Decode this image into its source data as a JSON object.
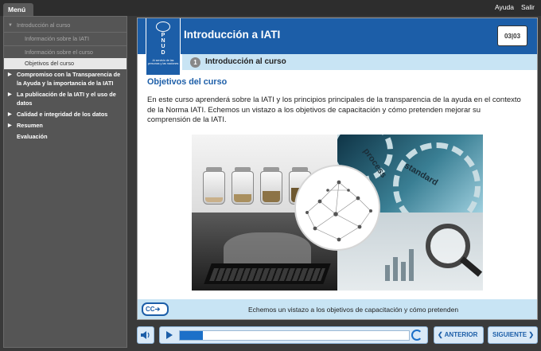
{
  "topbar": {
    "menu_label": "Menú",
    "help_label": "Ayuda",
    "exit_label": "Salir"
  },
  "sidebar": {
    "items": [
      {
        "label": "Introducción al curso"
      },
      {
        "label": "Información sobre la IATI"
      },
      {
        "label": "Información sobre el curso"
      },
      {
        "label": "Objetivos del curso"
      },
      {
        "label": "Compromiso con la Transparencia de la Ayuda y la importancia de la IATI"
      },
      {
        "label": "La publicación de la IATI y el uso de datos"
      },
      {
        "label": "Calidad e integridad de los datos"
      },
      {
        "label": "Resumen"
      },
      {
        "label": "Evaluación"
      }
    ]
  },
  "header": {
    "logo_text": "P\nN\nU\nD",
    "logo_tagline": "Al servicio de las personas y las naciones",
    "title": "Introducción a IATI",
    "page_current": "03",
    "page_total": "03"
  },
  "subheader": {
    "number": "1",
    "label": "Introducción al curso"
  },
  "content": {
    "section_title": "Objetivos del curso",
    "body": "En este curso aprenderá sobre la IATI y los principios principales de la transparencia de la ayuda en el contexto de la Norma IATI. Echemos un vistazo a los objetivos de capacitación y cómo pretenden mejorar su comprensión de la IATI.",
    "image_words": [
      "process",
      "standard"
    ]
  },
  "caption": {
    "cc_label": "CC",
    "text": "Echemos un vistazo a los objetivos de capacitación y cómo pretenden"
  },
  "player": {
    "progress_fraction": 0.1
  },
  "nav": {
    "prev_label": "ANTERIOR",
    "next_label": "SIGUIENTE"
  },
  "colors": {
    "brand_blue": "#1c5ea8",
    "light_blue": "#c8e4f4",
    "sidebar_bg": "#555555"
  }
}
